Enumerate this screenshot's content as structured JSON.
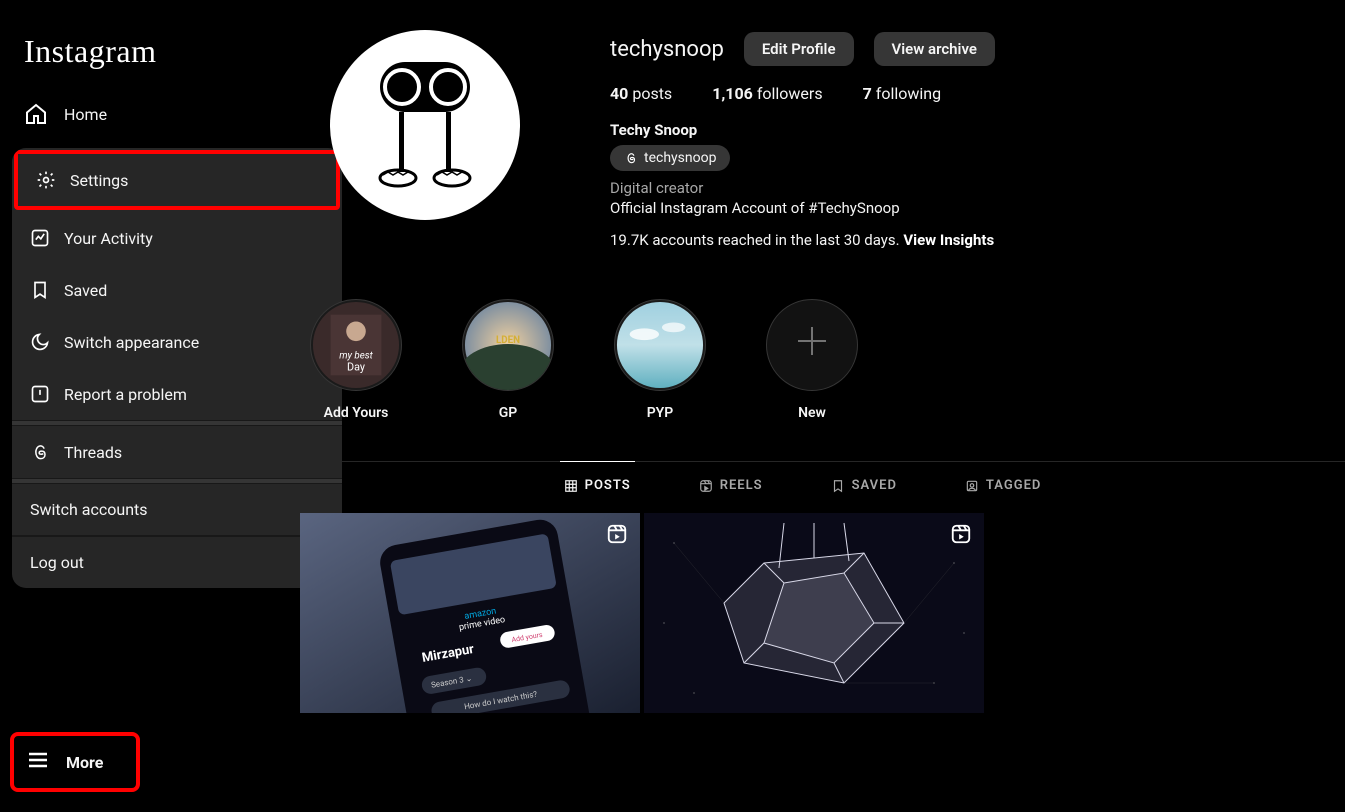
{
  "brand": "Instagram",
  "sidebar": {
    "home": "Home",
    "more": "More"
  },
  "moreMenu": {
    "settings": "Settings",
    "activity": "Your Activity",
    "saved": "Saved",
    "appearance": "Switch appearance",
    "report": "Report a problem",
    "threads": "Threads",
    "switch": "Switch accounts",
    "logout": "Log out"
  },
  "profile": {
    "username": "techysnoop",
    "editBtn": "Edit Profile",
    "archiveBtn": "View archive",
    "posts_count": "40",
    "posts_label": "posts",
    "followers_count": "1,106",
    "followers_label": "followers",
    "following_count": "7",
    "following_label": "following",
    "displayName": "Techy Snoop",
    "threadsHandle": "techysnoop",
    "category": "Digital creator",
    "bio": "Official Instagram Account of #TechySnoop",
    "insights_text": "19.7K accounts reached in the last 30 days. ",
    "insights_link": "View Insights"
  },
  "highlights": [
    {
      "label": "Add Yours"
    },
    {
      "label": "GP"
    },
    {
      "label": "PYP"
    },
    {
      "label": "New",
      "isNew": true
    }
  ],
  "tabs": {
    "posts": "POSTS",
    "reels": "REELS",
    "saved": "SAVED",
    "tagged": "TAGGED"
  }
}
